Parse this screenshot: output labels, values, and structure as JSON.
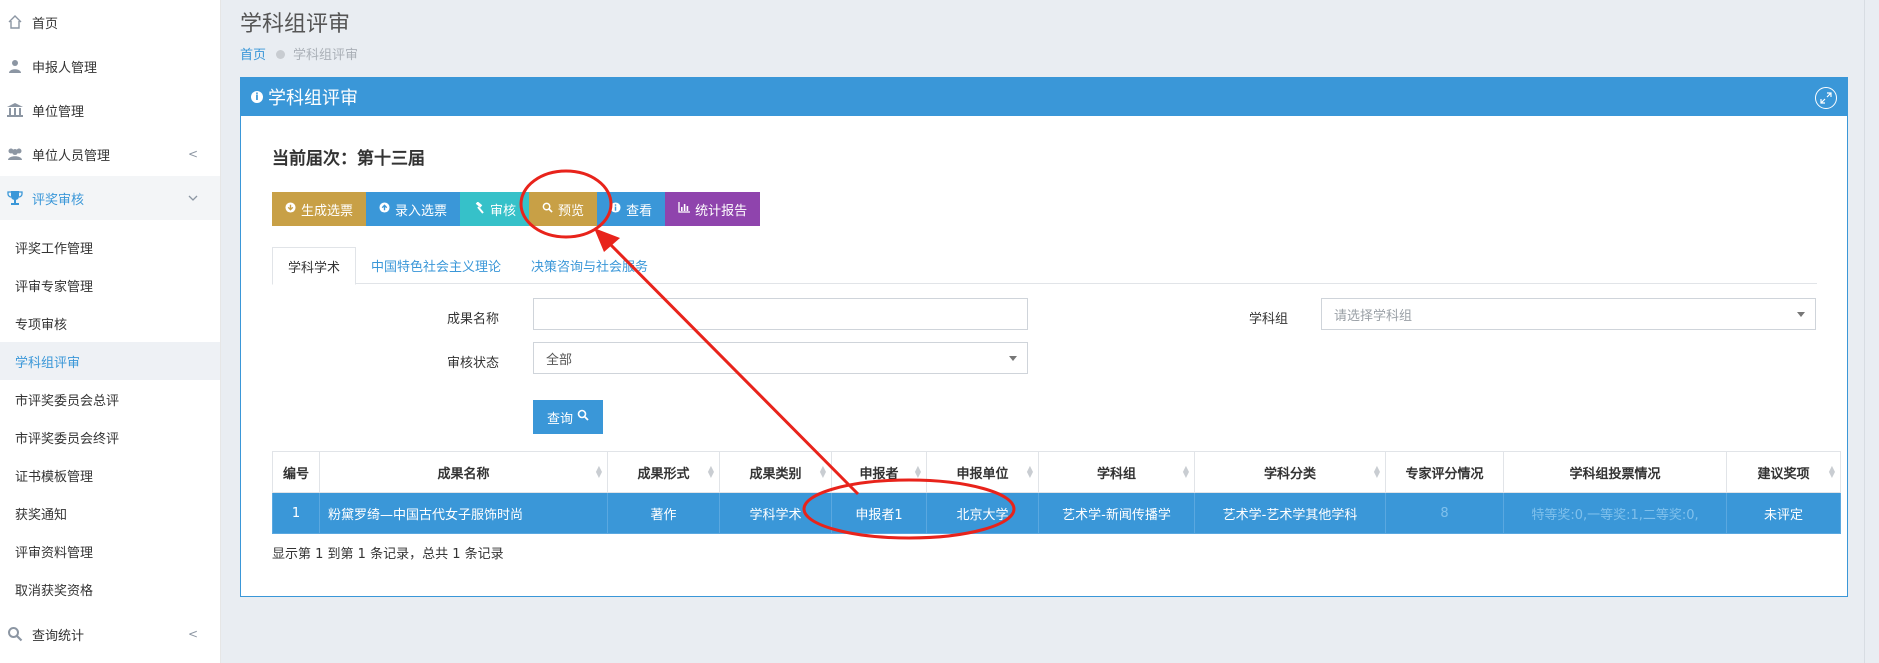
{
  "sidebar": {
    "items": [
      {
        "label": "首页",
        "icon": "home-icon"
      },
      {
        "label": "申报人管理",
        "icon": "user-icon"
      },
      {
        "label": "单位管理",
        "icon": "bank-icon"
      },
      {
        "label": "单位人员管理",
        "icon": "users-icon"
      },
      {
        "label": "评奖审核",
        "icon": "trophy-icon"
      }
    ],
    "sub_items": [
      {
        "label": "评奖工作管理"
      },
      {
        "label": "评审专家管理"
      },
      {
        "label": "专项审核"
      },
      {
        "label": "学科组评审"
      },
      {
        "label": "市评奖委员会总评"
      },
      {
        "label": "市评奖委员会终评"
      },
      {
        "label": "证书模板管理"
      },
      {
        "label": "获奖通知"
      },
      {
        "label": "评审资料管理"
      },
      {
        "label": "取消获奖资格"
      }
    ],
    "bottom_item": {
      "label": "查询统计",
      "icon": "search-icon"
    }
  },
  "header": {
    "title": "学科组评审",
    "breadcrumb": {
      "home": "首页",
      "current": "学科组评审"
    }
  },
  "panel": {
    "title": "学科组评审",
    "session_text": "当前届次：第十三届",
    "toolbar": {
      "generate": "生成选票",
      "input": "录入选票",
      "review": "审核",
      "preview": "预览",
      "view": "查看",
      "report": "统计报告"
    },
    "tabs": [
      "学科学术",
      "中国特色社会主义理论",
      "决策咨询与社会服务"
    ],
    "filters": {
      "name_label": "成果名称",
      "name_value": "",
      "group_label": "学科组",
      "group_placeholder": "请选择学科组",
      "status_label": "审核状态",
      "status_value": "全部",
      "query_button": "查询"
    },
    "table": {
      "columns": [
        "编号",
        "成果名称",
        "成果形式",
        "成果类别",
        "申报者",
        "申报单位",
        "学科组",
        "学科分类",
        "专家评分情况",
        "学科组投票情况",
        "建议奖项"
      ],
      "rows": [
        [
          "1",
          "粉黛罗绮—中国古代女子服饰时尚",
          "著作",
          "学科学术",
          "申报者1",
          "北京大学",
          "艺术学-新闻传播学",
          "艺术学-艺术学其他学科",
          "8",
          "特等奖:0,一等奖:1,二等奖:0,",
          "未评定"
        ]
      ]
    },
    "footer": "显示第 1 到第 1 条记录，总共 1 条记录"
  },
  "colors": {
    "primary": "#3a97d8",
    "gold": "#c8a046",
    "teal": "#36c1c9",
    "purple": "#8f44ad",
    "annotation_red": "#e8231b"
  }
}
